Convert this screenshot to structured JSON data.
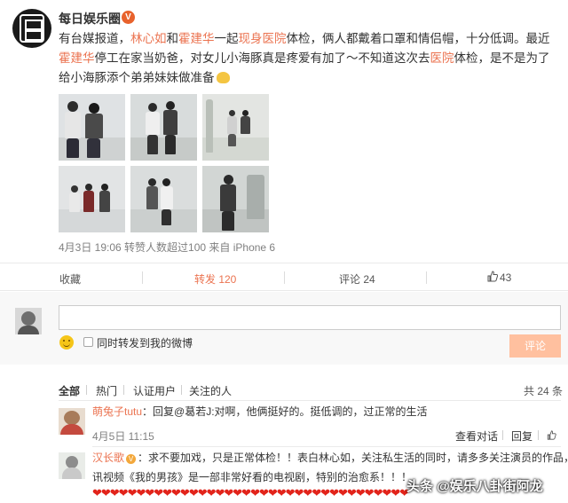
{
  "post": {
    "author": "每日娱乐圈",
    "verified_badge": "V",
    "text_parts": [
      {
        "t": "有台媒报道，",
        "hl": false
      },
      {
        "t": "林心如",
        "hl": true
      },
      {
        "t": "和",
        "hl": false
      },
      {
        "t": "霍建华",
        "hl": true
      },
      {
        "t": "一起",
        "hl": false
      },
      {
        "t": "现身医院",
        "hl": true
      },
      {
        "t": "体检，俩人都戴着口罩和情侣帽，十分低调。最近",
        "hl": false
      },
      {
        "t": "霍建华",
        "hl": true
      },
      {
        "t": "停工在家当奶爸，对女儿小海豚真是疼爱有加了～不知道这次去",
        "hl": false
      },
      {
        "t": "医院",
        "hl": true
      },
      {
        "t": "体检，是不是为了给小海豚添个弟弟妹妹做准备",
        "hl": false
      }
    ],
    "meta": "4月3日 19:06 转赞人数超过100 来自 iPhone 6"
  },
  "actions": {
    "favorite": "收藏",
    "repost": "转发 120",
    "comment": "评论 24",
    "like": "43"
  },
  "comment_box": {
    "input_value": "",
    "share_label": "同时转发到我的微博",
    "submit": "评论"
  },
  "filters": {
    "items": [
      "全部",
      "热门",
      "认证用户",
      "关注的人"
    ],
    "total": "共 24 条"
  },
  "comments": [
    {
      "name": "萌兔子tutu",
      "text": "：回复@葛若J:对啊，他俩挺好的。挺低调的，过正常的生活",
      "time": "4月5日 11:15",
      "links": [
        "查看对话",
        "回复"
      ]
    },
    {
      "name": "汉长歌",
      "badge": "V",
      "line1": "：求不要加戏，只是正常体检！！表白林心如，关注私生活的同时，请多多关注演员的作品，腾",
      "line2": "讯视频《我的男孩》是一部非常好看的电视剧，特别的治愈系！！！",
      "hearts": "❤❤❤❤❤❤❤❤❤❤❤❤❤❤❤❤❤❤❤❤❤❤❤❤❤❤❤❤❤❤❤❤❤❤❤❤"
    }
  ],
  "watermark": "头条 @娱乐八卦街阿龙",
  "colors": {
    "accent": "#eb7350",
    "submit_disabled": "#ffc09f",
    "meta_gray": "#808080"
  },
  "icons": [
    "verified-badge-icon",
    "thumb-up-icon",
    "smile-emoji-icon",
    "checkbox-icon",
    "heart-icon"
  ]
}
